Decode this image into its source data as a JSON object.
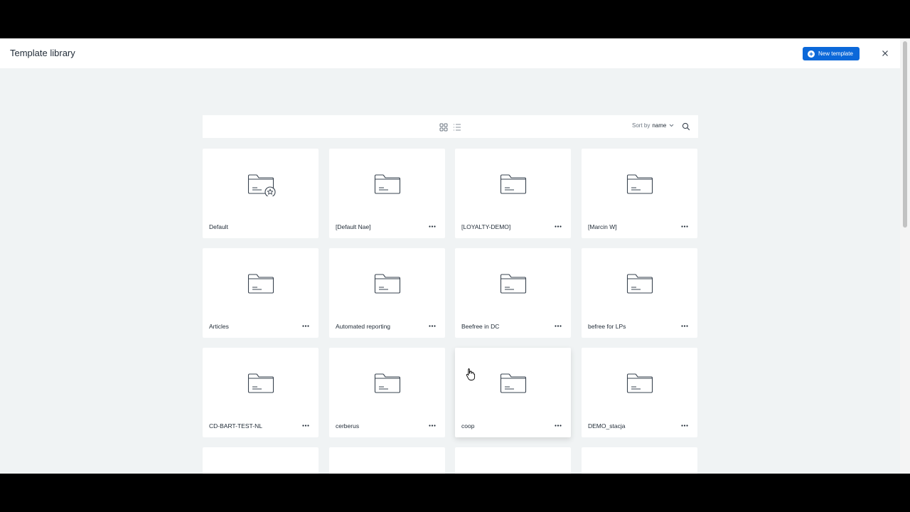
{
  "header": {
    "title": "Template library",
    "new_template_label": "New template",
    "close_icon": "close-icon"
  },
  "toolbar": {
    "grid_view_icon": "grid-view-icon",
    "list_view_icon": "list-view-icon",
    "sort_prefix": "Sort by",
    "sort_value": "name",
    "search_icon": "search-icon"
  },
  "templates": [
    {
      "name": "Default",
      "icon": "folder-star-icon",
      "has_menu": false
    },
    {
      "name": "[Default Nae]",
      "icon": "folder-icon",
      "has_menu": true
    },
    {
      "name": "[LOYALTY-DEMO]",
      "icon": "folder-icon",
      "has_menu": true
    },
    {
      "name": "[Marcin W]",
      "icon": "folder-icon",
      "has_menu": true
    },
    {
      "name": "Articles",
      "icon": "folder-icon",
      "has_menu": true
    },
    {
      "name": "Automated reporting",
      "icon": "folder-icon",
      "has_menu": true
    },
    {
      "name": "Beefree in DC",
      "icon": "folder-icon",
      "has_menu": true
    },
    {
      "name": "befree for LPs",
      "icon": "folder-icon",
      "has_menu": true
    },
    {
      "name": "CD-BART-TEST-NL",
      "icon": "folder-icon",
      "has_menu": true
    },
    {
      "name": "cerberus",
      "icon": "folder-icon",
      "has_menu": true
    },
    {
      "name": "coop",
      "icon": "folder-icon",
      "has_menu": true
    },
    {
      "name": "DEMO_stacja",
      "icon": "folder-icon",
      "has_menu": true
    }
  ],
  "colors": {
    "accent": "#0b68d9",
    "background": "#f0f3f4",
    "card": "#ffffff",
    "text": "#1f2a36"
  }
}
